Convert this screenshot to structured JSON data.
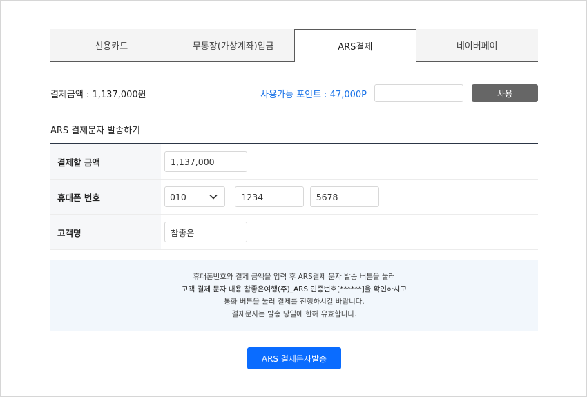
{
  "tabs": [
    {
      "label": "신용카드",
      "active": false
    },
    {
      "label": "무통장(가상계좌)입금",
      "active": false
    },
    {
      "label": "ARS결제",
      "active": true
    },
    {
      "label": "네이버페이",
      "active": false
    }
  ],
  "payment": {
    "amount_label": "결제금액 : 1,137,000원",
    "points_label": "사용가능 포인트 : 47,000P",
    "points_input_value": "",
    "use_button": "사용"
  },
  "section": {
    "title": "ARS 결제문자 발송하기"
  },
  "form": {
    "amount": {
      "label": "결제할 금액",
      "value": "1,137,000"
    },
    "phone": {
      "label": "휴대폰 번호",
      "prefix": "010",
      "middle": "1234",
      "last": "5678",
      "dash": "-"
    },
    "name": {
      "label": "고객명",
      "value": "참좋은"
    }
  },
  "notice": {
    "line1": "휴대폰번호와 결제 금액을 입력 후 ARS결제 문자 발송 버튼을 눌러",
    "line2": "고객 결제 문자 내용 참좋은여행(주)_ARS 인증번호[******]을 확인하시고",
    "line3": "통화 버튼을 눌러 결제를 진행하시길 바랍니다.",
    "line4": "결제문자는 발송 당일에 한해 유효합니다."
  },
  "submit_button": "ARS 결제문자발송",
  "colors": {
    "accent": "#0a6cff",
    "points": "#1a73e8",
    "use_button": "#666666",
    "notice_bg": "#f2f7fc"
  }
}
